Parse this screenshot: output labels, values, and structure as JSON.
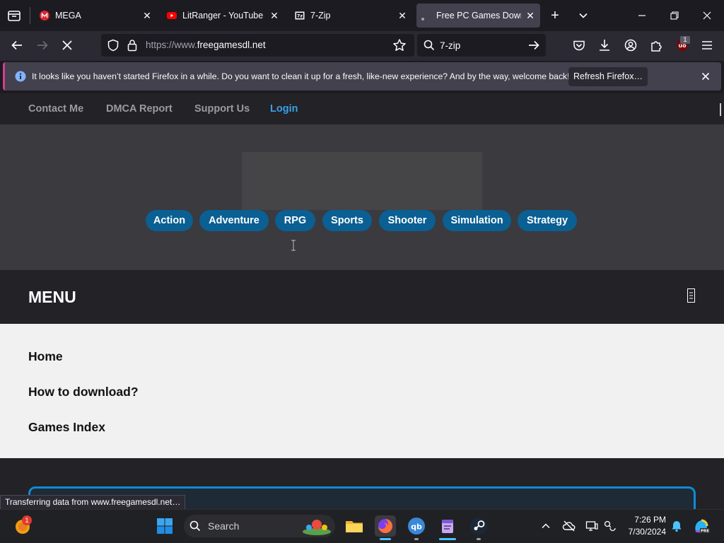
{
  "tabs": [
    {
      "title": "MEGA",
      "icon": "mega-logo-icon"
    },
    {
      "title": "LitRanger - YouTube",
      "icon": "youtube-icon"
    },
    {
      "title": "7-Zip",
      "icon": "7zip-icon"
    },
    {
      "title": "Free PC Games Downlo",
      "icon": "loading-dot-icon",
      "active": true
    }
  ],
  "urlbar": {
    "url_prefix": "https://www.",
    "url_domain": "freegamesdl.net"
  },
  "searchbar": {
    "query": "7-zip"
  },
  "extension_badge": "1",
  "notification": {
    "message": "It looks like you haven’t started Firefox in a while. Do you want to clean it up for a fresh, like-new experience? And by the way, welcome back!",
    "button_label": "Refresh Firefox…"
  },
  "site_nav": {
    "contact": "Contact Me",
    "dmca": "DMCA Report",
    "support": "Support Us",
    "login": "Login"
  },
  "categories": [
    "Action",
    "Adventure",
    "RPG",
    "Sports",
    "Shooter",
    "Simulation",
    "Strategy"
  ],
  "menu": {
    "title": "MENU",
    "items": [
      "Home",
      "How to download?",
      "Games Index"
    ]
  },
  "status_text": "Transferring data from www.freegamesdl.net…",
  "taskbar": {
    "search_placeholder": "Search",
    "time": "7:26 PM",
    "date": "7/30/2024",
    "notification_count": "1"
  },
  "colors": {
    "accent_blue": "#0a5f93",
    "login_link": "#3aa0e6",
    "notification_stripe": "#d63c91",
    "cyan_border": "#0f8bd6"
  }
}
